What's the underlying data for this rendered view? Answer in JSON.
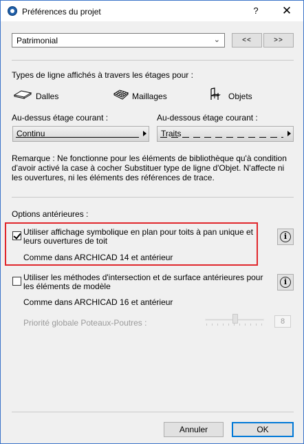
{
  "window": {
    "title": "Préférences du projet",
    "help_glyph": "?",
    "close_glyph": "✕"
  },
  "preset": {
    "selected": "Patrimonial",
    "prev_label": "<<",
    "next_label": ">>"
  },
  "line_types": {
    "heading": "Types de ligne affichés à travers les étages pour :",
    "elements": [
      {
        "label": "Dalles",
        "icon": "slab-icon"
      },
      {
        "label": "Maillages",
        "icon": "mesh-icon"
      },
      {
        "label": "Objets",
        "icon": "chair-icon"
      }
    ],
    "above_label": "Au-dessus étage courant :",
    "above_value": "Continu",
    "below_label": "Au-dessous étage courant :",
    "below_value": "Traits",
    "remark": "Remarque : Ne fonctionne pour les éléments de bibliothèque qu'à condition d'avoir activé la case à cocher Substituer type de ligne d'Objet. N'affecte ni les ouvertures, ni les éléments des références de trace."
  },
  "legacy": {
    "heading": "Options antérieures :",
    "option1": {
      "checked": true,
      "text": "Utiliser affichage symbolique en plan pour toits à pan unique et leurs ouvertures de toit",
      "note": "Comme dans ARCHICAD 14 et antérieur"
    },
    "option2": {
      "checked": false,
      "text": "Utiliser les méthodes d'intersection et de surface antérieures pour les éléments de modèle",
      "note": "Comme dans ARCHICAD 16 et antérieur"
    },
    "priority_label": "Priorité globale Poteaux-Poutres :",
    "priority_value": "8"
  },
  "footer": {
    "cancel": "Annuler",
    "ok": "OK"
  },
  "colors": {
    "highlight": "#e0262b",
    "window_border": "#3c74c9",
    "primary_border": "#0078d7"
  }
}
